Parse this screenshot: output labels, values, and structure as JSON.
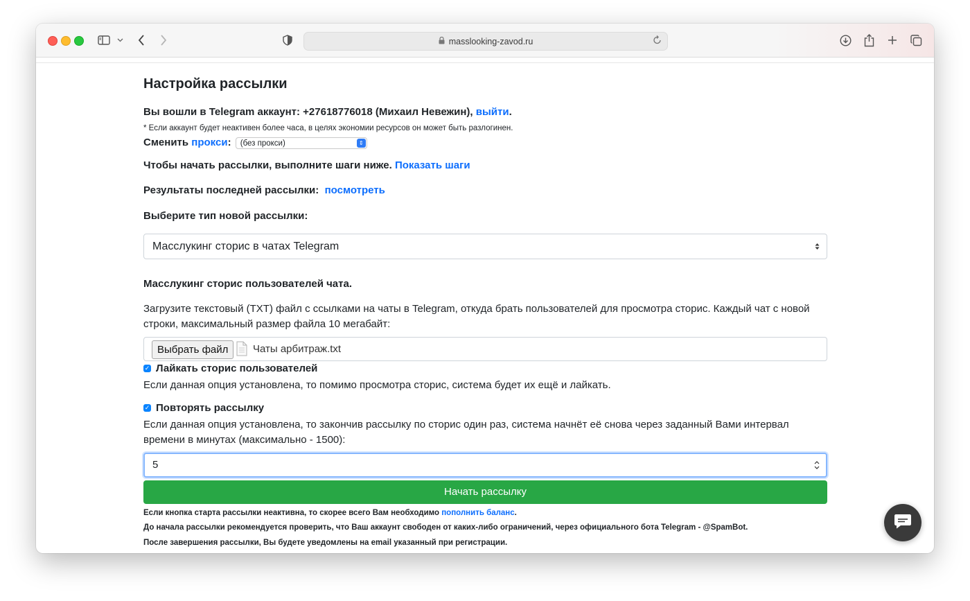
{
  "browser": {
    "url": "masslooking-zavod.ru"
  },
  "page": {
    "title": "Настройка рассылки",
    "account": {
      "prefix": "Вы вошли в Telegram аккаунт: +27618776018 (Михаил Невежин), ",
      "logout_link": "выйти",
      "suffix": "."
    },
    "inactivity_note": "* Если аккаунт будет неактивен более часа, в целях экономии ресурсов он может быть разлогинен.",
    "proxy": {
      "prefix": "Сменить ",
      "link": "прокси",
      "colon": ":",
      "selected": "(без прокси)"
    },
    "steps": {
      "text": "Чтобы начать рассылки, выполните шаги ниже. ",
      "link": "Показать шаги"
    },
    "last_results": {
      "text": "Результаты последней рассылки: ",
      "link": "посмотреть"
    },
    "type_label": "Выберите тип новой рассылки:",
    "type_selected": "Масслукинг сторис в чатах Telegram",
    "section_heading": "Масслукинг сторис пользователей чата.",
    "upload_description": "Загрузите текстовый (TXT) файл с ссылками на чаты в Telegram, откуда брать пользователей для просмотра сторис. Каждый чат с новой строки, максимальный размер файла 10 мегабайт:",
    "file": {
      "button_label": "Выбрать файл",
      "file_name": "Чаты арбитраж.txt"
    },
    "like_option": {
      "checked": true,
      "label": "Лайкать сторис пользователей",
      "description": "Если данная опция установлена, то помимо просмотра сторис, система будет их ещё и лайкать."
    },
    "repeat_option": {
      "checked": true,
      "label": "Повторять рассылку",
      "description": "Если данная опция установлена, то закончив рассылку по сторис один раз, система начнёт её снова через заданный Вами интервал времени в минутах (максимально - 1500):",
      "interval_value": "5"
    },
    "start_button": "Начать рассылку",
    "footer": {
      "inactive_text": "Если кнопка старта рассылки неактивна, то скорее всего Вам необходимо ",
      "balance_link": "пополнить баланс",
      "inactive_suffix": ".",
      "spambot_note": "До начала рассылки рекомендуется проверить, что Ваш аккаунт свободен от каких-либо ограничений, через официального бота Telegram - @SpamBot.",
      "email_note": "После завершения рассылки, Вы будете уведомлены на email указанный при регистрации."
    }
  },
  "colors": {
    "link": "#0d6efd",
    "start_button": "#28a745",
    "focus_border": "#86b7fe"
  },
  "icons": [
    "sidebar-icon",
    "chevron-down-icon",
    "back-arrow-icon",
    "forward-arrow-icon",
    "shield-icon",
    "lock-icon",
    "reload-icon",
    "download-icon",
    "share-icon",
    "plus-icon",
    "tabs-icon",
    "file-icon",
    "chat-icon"
  ]
}
